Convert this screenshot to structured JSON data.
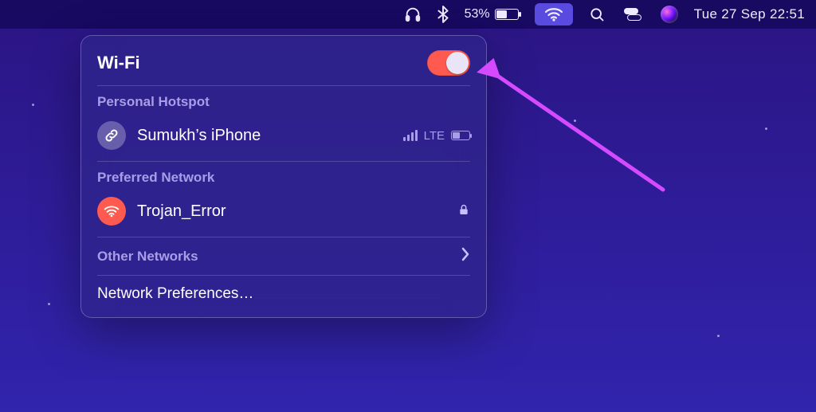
{
  "menubar": {
    "battery_pct_label": "53%",
    "battery_fill_pct": 53,
    "clock": "Tue 27 Sep  22:51"
  },
  "wifi_panel": {
    "title": "Wi-Fi",
    "toggle_on": true,
    "sections": {
      "hotspot": {
        "label": "Personal Hotspot",
        "device_name": "Sumukh’s iPhone",
        "cell_band": "LTE"
      },
      "preferred": {
        "label": "Preferred Network",
        "network_name": "Trojan_Error",
        "locked": true
      },
      "other_label": "Other Networks",
      "prefs_label": "Network Preferences…"
    }
  }
}
